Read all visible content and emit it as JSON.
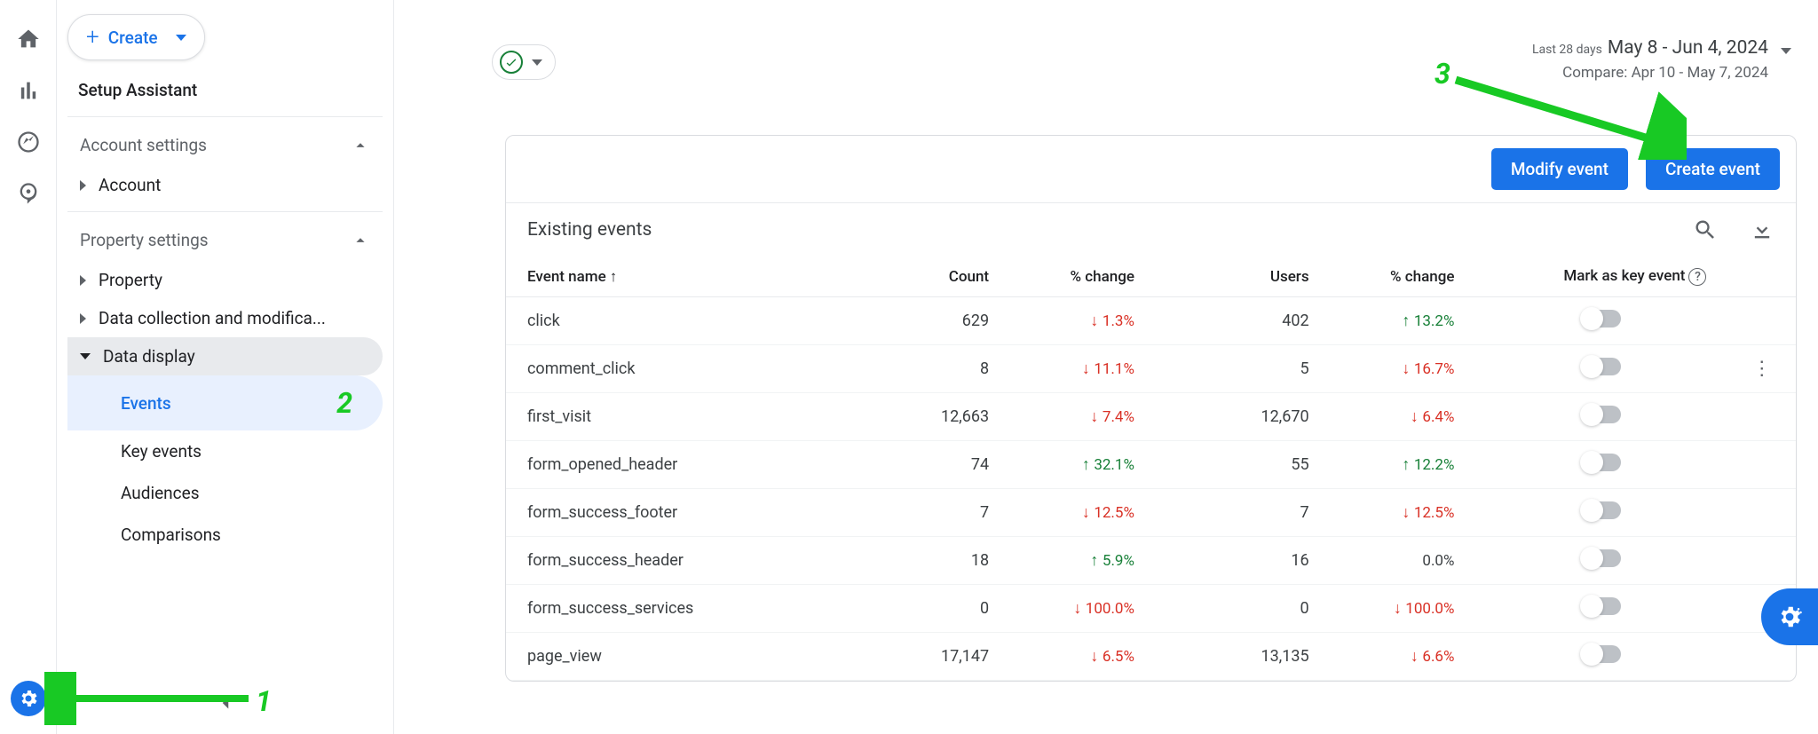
{
  "create": {
    "label": "Create"
  },
  "setup_assistant": "Setup Assistant",
  "sections": {
    "account": {
      "label": "Account settings",
      "items": [
        "Account"
      ]
    },
    "property": {
      "label": "Property settings",
      "items": [
        "Property",
        "Data collection and modifica..."
      ],
      "data_display": {
        "label": "Data display",
        "children": [
          "Events",
          "Key events",
          "Audiences",
          "Comparisons"
        ]
      }
    }
  },
  "date": {
    "label": "Last 28 days",
    "range": "May 8 - Jun 4, 2024",
    "compare": "Compare: Apr 10 - May 7, 2024"
  },
  "actions": {
    "modify": "Modify event",
    "create": "Create event"
  },
  "table": {
    "title": "Existing events",
    "cols": {
      "name": "Event name",
      "count": "Count",
      "change1": "% change",
      "users": "Users",
      "change2": "% change",
      "key": "Mark as key event"
    },
    "rows": [
      {
        "name": "click",
        "count": "629",
        "c1": "1.3%",
        "d1": "down",
        "users": "402",
        "c2": "13.2%",
        "d2": "up"
      },
      {
        "name": "comment_click",
        "count": "8",
        "c1": "11.1%",
        "d1": "down",
        "users": "5",
        "c2": "16.7%",
        "d2": "down",
        "more": true
      },
      {
        "name": "first_visit",
        "count": "12,663",
        "c1": "7.4%",
        "d1": "down",
        "users": "12,670",
        "c2": "6.4%",
        "d2": "down"
      },
      {
        "name": "form_opened_header",
        "count": "74",
        "c1": "32.1%",
        "d1": "up",
        "users": "55",
        "c2": "12.2%",
        "d2": "up"
      },
      {
        "name": "form_success_footer",
        "count": "7",
        "c1": "12.5%",
        "d1": "down",
        "users": "7",
        "c2": "12.5%",
        "d2": "down"
      },
      {
        "name": "form_success_header",
        "count": "18",
        "c1": "5.9%",
        "d1": "up",
        "users": "16",
        "c2": "0.0%",
        "d2": "neutral"
      },
      {
        "name": "form_success_services",
        "count": "0",
        "c1": "100.0%",
        "d1": "down",
        "users": "0",
        "c2": "100.0%",
        "d2": "down"
      },
      {
        "name": "page_view",
        "count": "17,147",
        "c1": "6.5%",
        "d1": "down",
        "users": "13,135",
        "c2": "6.6%",
        "d2": "down"
      }
    ]
  },
  "annotations": {
    "n1": "1",
    "n2": "2",
    "n3": "3"
  }
}
